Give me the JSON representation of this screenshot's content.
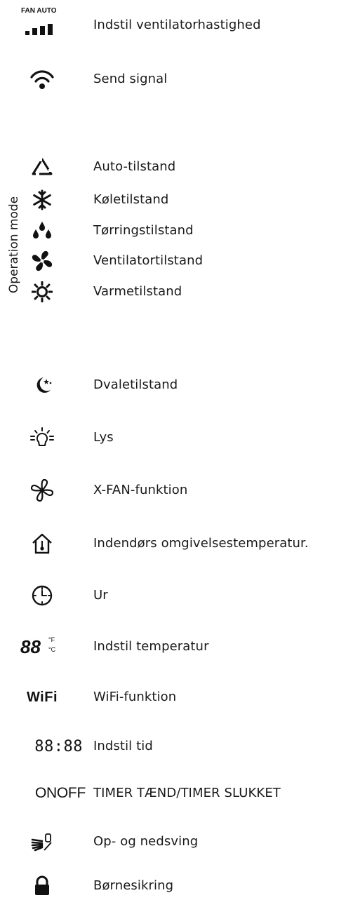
{
  "side_label": "Operation mode",
  "icons": {
    "fan_speed_header": "FAN AUTO",
    "temp_digits": "88",
    "temp_units_f": "°F",
    "temp_units_c": "°C",
    "wifi": "WiFi",
    "time_digits": "88:88",
    "on_off": "ONOFF"
  },
  "items": [
    {
      "icon": "fan-speed-bars-icon",
      "label": "Indstil ventilatorhastighed"
    },
    {
      "icon": "signal-icon",
      "label": "Send signal"
    },
    {
      "icon": "auto-mode-icon",
      "label": "Auto-tilstand"
    },
    {
      "icon": "snowflake-icon",
      "label": "Køletilstand"
    },
    {
      "icon": "drops-icon",
      "label": "Tørringstilstand"
    },
    {
      "icon": "fan-blade-icon",
      "label": "Ventilatortilstand"
    },
    {
      "icon": "sun-icon",
      "label": "Varmetilstand"
    },
    {
      "icon": "moon-stars-icon",
      "label": "Dvaletilstand"
    },
    {
      "icon": "light-bulb-icon",
      "label": "Lys"
    },
    {
      "icon": "x-fan-icon",
      "label": "X-FAN-funktion"
    },
    {
      "icon": "house-thermometer-icon",
      "label": "Indendørs omgivelsestemperatur."
    },
    {
      "icon": "clock-icon",
      "label": "Ur"
    },
    {
      "icon": "temperature-digits-icon",
      "label": "Indstil temperatur"
    },
    {
      "icon": "wifi-text-icon",
      "label": "WiFi-funktion"
    },
    {
      "icon": "time-digits-icon",
      "label": "Indstil tid"
    },
    {
      "icon": "on-off-text-icon",
      "label": "TIMER TÆND/TIMER SLUKKET"
    },
    {
      "icon": "swing-icon",
      "label": "Op- og nedsving"
    },
    {
      "icon": "lock-icon",
      "label": "Børnesikring"
    }
  ]
}
